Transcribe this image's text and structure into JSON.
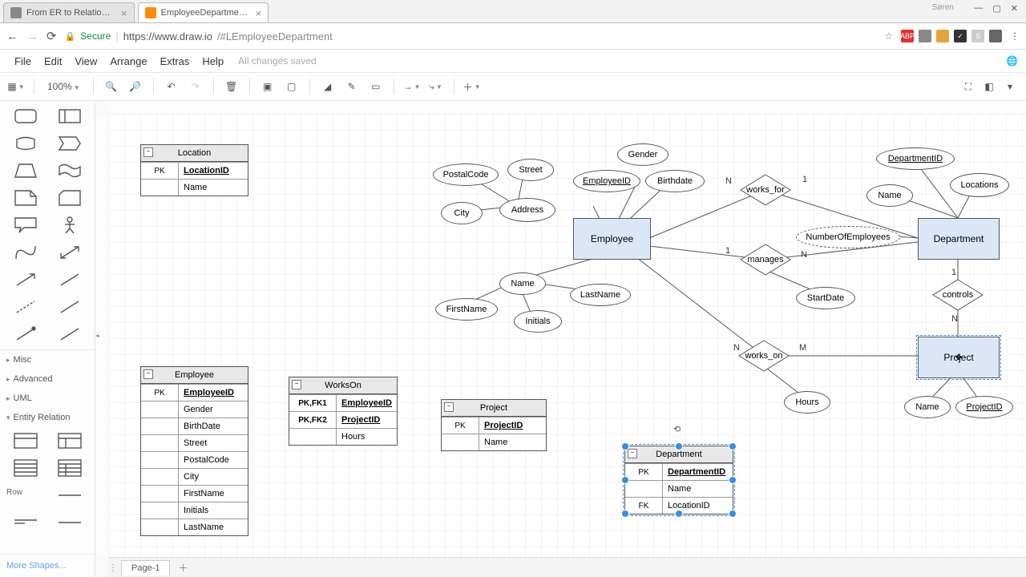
{
  "browser": {
    "tabs": [
      {
        "title": "From ER to Relational M…",
        "active": false
      },
      {
        "title": "EmployeeDepartment - d",
        "active": true
      }
    ],
    "profile_name": "Søren",
    "win": {
      "min": "—",
      "max": "▢",
      "close": "✕"
    },
    "nav": {
      "back": "←",
      "fwd": "→",
      "reload": "⟳"
    },
    "secure_label": "Secure",
    "url_host": "https://www.draw.io",
    "url_path": "/#LEmployeeDepartment",
    "star": "☆",
    "menu_dots": "⋮",
    "extensions": [
      {
        "bg": "#d33",
        "txt": "ABP"
      },
      {
        "bg": "#888",
        "txt": ""
      },
      {
        "bg": "#e8a23a",
        "txt": ""
      },
      {
        "bg": "#333",
        "txt": "✓"
      },
      {
        "bg": "#ccc",
        "txt": "S"
      },
      {
        "bg": "#666",
        "txt": ""
      }
    ]
  },
  "app": {
    "menu": [
      "File",
      "Edit",
      "View",
      "Arrange",
      "Extras",
      "Help"
    ],
    "save_status": "All changes saved",
    "zoom": "100%",
    "page_tab": "Page-1",
    "more_shapes": "More Shapes...",
    "categories": [
      "Misc",
      "Advanced",
      "UML",
      "Entity Relation"
    ],
    "row_label": "Row"
  },
  "tables": {
    "location": {
      "title": "Location",
      "rows": [
        {
          "k": "PK",
          "n": "LocationID",
          "pk": true
        },
        {
          "k": "",
          "n": "Name"
        }
      ]
    },
    "employee_tbl": {
      "title": "Employee",
      "rows": [
        {
          "k": "PK",
          "n": "EmployeeID",
          "pk": true
        },
        {
          "k": "",
          "n": "Gender"
        },
        {
          "k": "",
          "n": "BirthDate"
        },
        {
          "k": "",
          "n": "Street"
        },
        {
          "k": "",
          "n": "PostalCode"
        },
        {
          "k": "",
          "n": "City"
        },
        {
          "k": "",
          "n": "FirstName"
        },
        {
          "k": "",
          "n": "Initials"
        },
        {
          "k": "",
          "n": "LastName"
        }
      ]
    },
    "workson": {
      "title": "WorksOn",
      "rows": [
        {
          "k": "PK,FK1",
          "n": "EmployeeID",
          "pk": true
        },
        {
          "k": "PK,FK2",
          "n": "ProjectID",
          "pk": true
        },
        {
          "k": "",
          "n": "Hours"
        }
      ]
    },
    "project_tbl": {
      "title": "Project",
      "rows": [
        {
          "k": "PK",
          "n": "ProjectID",
          "pk": true
        },
        {
          "k": "",
          "n": "Name"
        }
      ]
    },
    "department_tbl": {
      "title": "Department",
      "rows": [
        {
          "k": "PK",
          "n": "DepartmentID",
          "pk": true
        },
        {
          "k": "",
          "n": "Name"
        },
        {
          "k": "FK",
          "n": "LocationID"
        }
      ]
    }
  },
  "er": {
    "entities": {
      "employee": "Employee",
      "department": "Department",
      "project": "Project"
    },
    "relationships": {
      "works_for": "works_for",
      "manages": "manages",
      "works_on": "works_on",
      "controls": "controls"
    },
    "attributes": {
      "gender": "Gender",
      "birthdate": "Birthdate",
      "employee_id": "EmployeeID",
      "postalcode": "PostalCode",
      "street": "Street",
      "address": "Address",
      "city": "City",
      "name_e": "Name",
      "firstname": "FirstName",
      "lastname": "LastName",
      "initials": "Initials",
      "dept_id": "DepartmentID",
      "locations": "Locations",
      "name_d": "Name",
      "num_emp": "NumberOfEmployees",
      "startdate": "StartDate",
      "hours": "Hours",
      "name_p": "Name",
      "project_id": "ProjectID"
    },
    "card": {
      "n": "N",
      "m": "M",
      "one": "1"
    }
  }
}
